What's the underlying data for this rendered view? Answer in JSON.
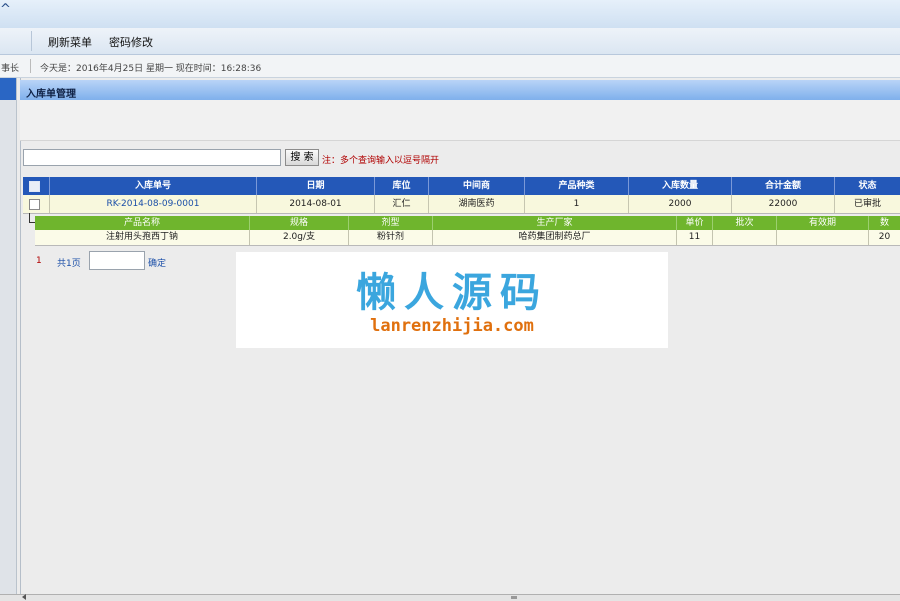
{
  "top": {
    "glyph": "^"
  },
  "menu": {
    "items": [
      "刷新菜单",
      "密码修改"
    ]
  },
  "info": {
    "user": "事长",
    "today_label": "今天是：2016年4月25日  星期一  现在时间：16:28:36"
  },
  "panel": {
    "title": "入库单管理"
  },
  "search": {
    "value": "",
    "button_label": "搜 索",
    "note": "注：多个查询输入以逗号隔开"
  },
  "grid": {
    "columns": [
      "入库单号",
      "日期",
      "库位",
      "中间商",
      "产品种类",
      "入库数量",
      "合计金额",
      "状态"
    ],
    "rows": [
      {
        "order_no": "RK-2014-08-09-0001",
        "date": "2014-08-01",
        "location": "汇仁",
        "dealer": "湖南医药",
        "product_types": "1",
        "quantity": "2000",
        "amount": "22000",
        "status": "已审批"
      }
    ]
  },
  "sub_grid": {
    "columns": [
      "产品名称",
      "规格",
      "剂型",
      "生产厂家",
      "单价",
      "批次",
      "有效期",
      "数"
    ],
    "rows": [
      {
        "name": "注射用头孢西丁钠",
        "spec": "2.0g/支",
        "form": "粉针剂",
        "maker": "哈药集团制药总厂",
        "price": "11",
        "batch": "",
        "expiry": "",
        "qty": "20"
      }
    ]
  },
  "pager": {
    "page": "1",
    "total": "共1页",
    "input_value": "",
    "confirm_label": "确定"
  },
  "watermark": {
    "title": "懒人源码",
    "url": "lanrenzhijia.com"
  },
  "colors": {
    "grid_header": "#2458b8",
    "sub_header": "#6fb52d",
    "row_bg": "#f8f8dd",
    "note_red": "#b00000",
    "link_blue": "#1b4fa8",
    "watermark_blue": "#3ba6de",
    "watermark_orange": "#e0700e"
  }
}
